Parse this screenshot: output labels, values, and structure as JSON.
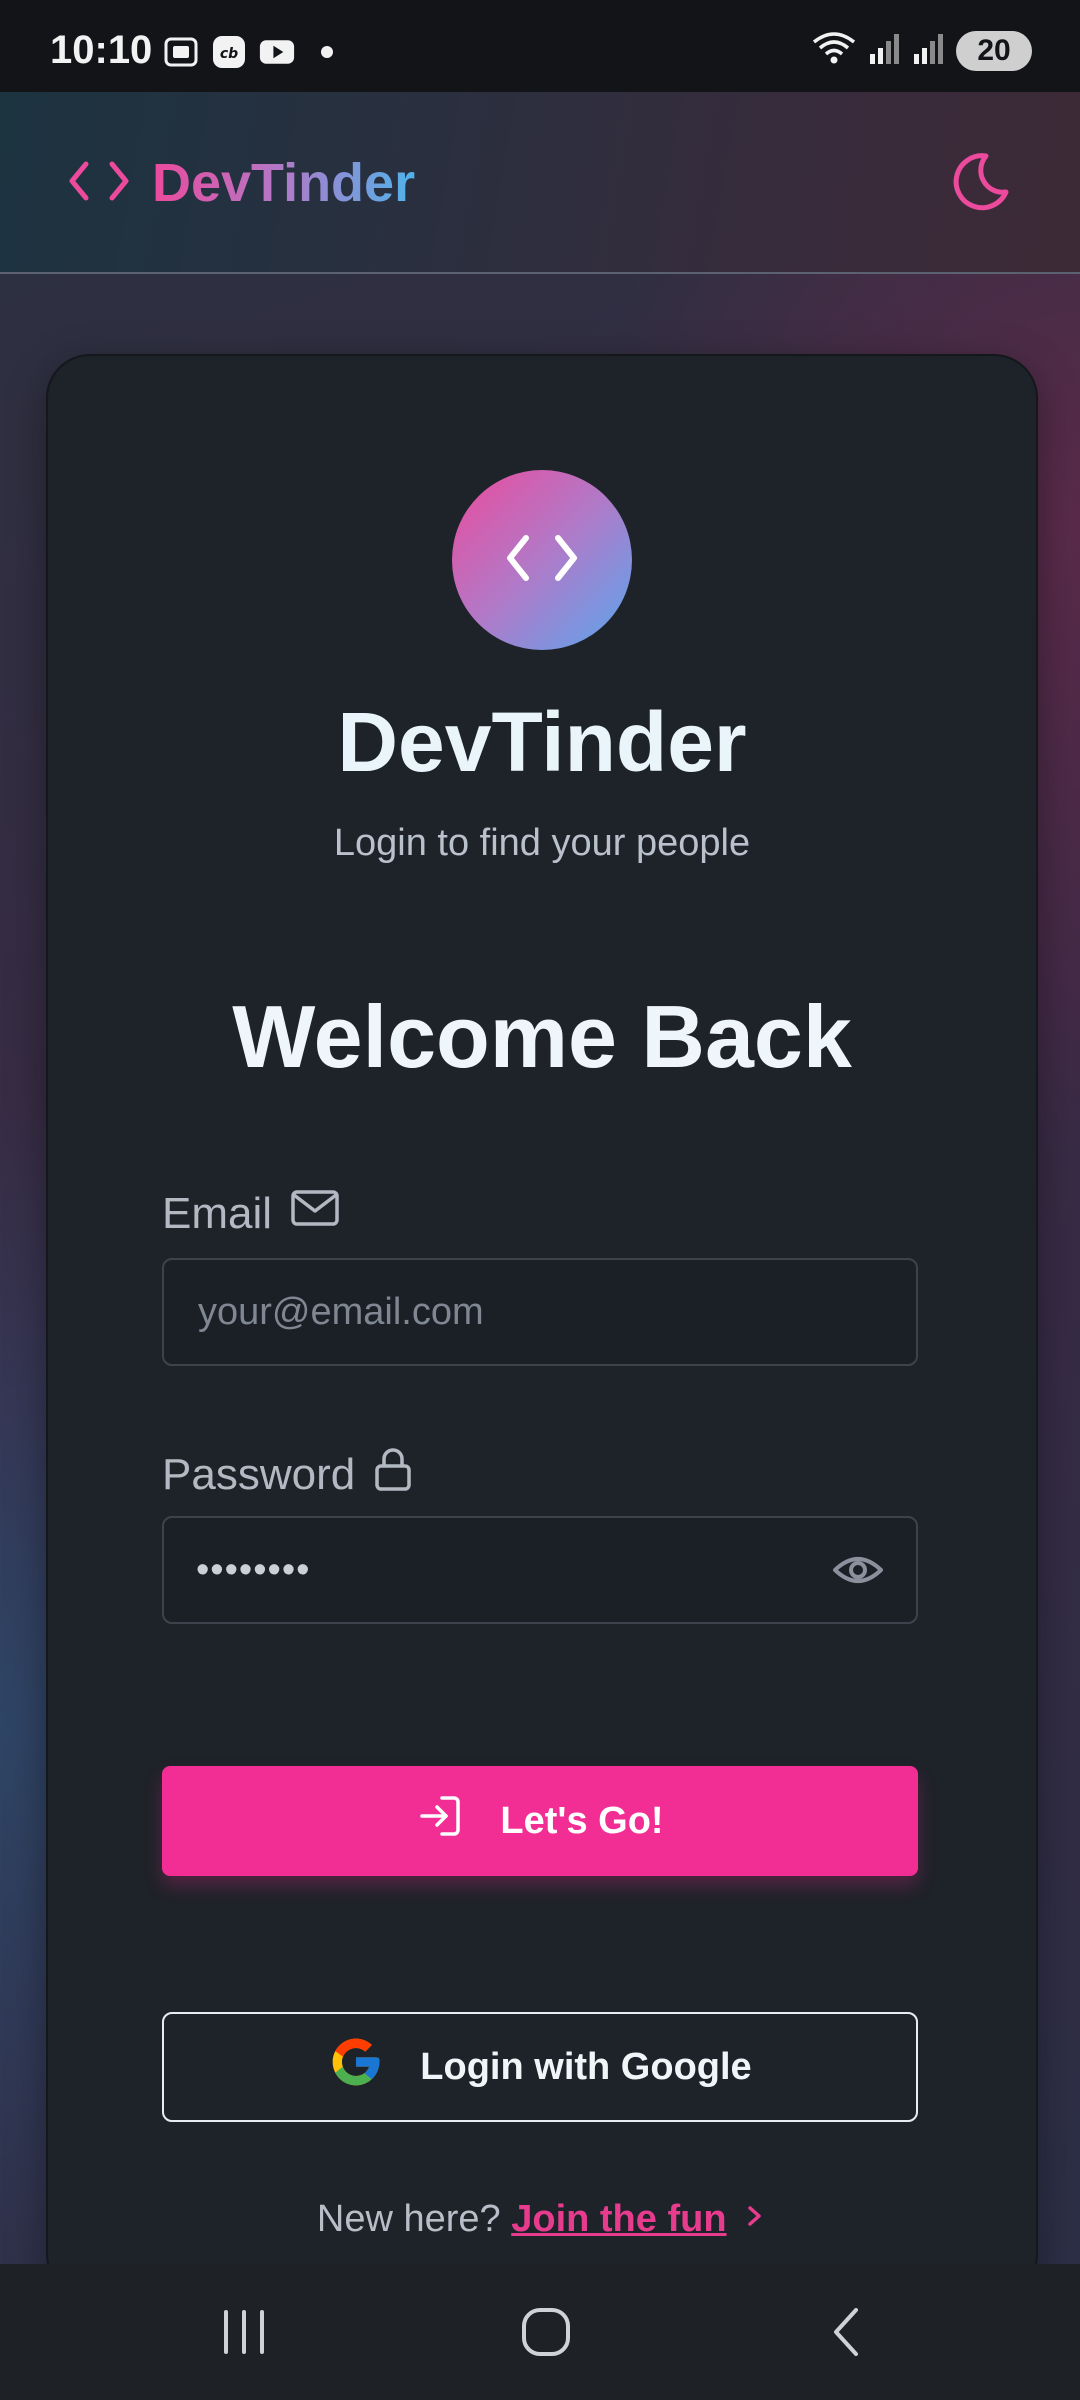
{
  "status_bar": {
    "time": "10:10",
    "battery": "20",
    "icons": [
      "gallery-icon",
      "cb-app-icon",
      "youtube-icon",
      "dot-icon",
      "wifi-icon",
      "signal-icon",
      "signal-icon"
    ]
  },
  "header": {
    "brand": "DevTinder",
    "brand_icon": "code-icon",
    "theme_icon": "moon-icon"
  },
  "card": {
    "title": "DevTinder",
    "subtitle": "Login to find your people",
    "heading": "Welcome Back",
    "email": {
      "label": "Email",
      "placeholder": "your@email.com",
      "value": ""
    },
    "password": {
      "label": "Password",
      "value": "••••••••"
    },
    "submit_label": "Let's Go!",
    "google_label": "Login with Google",
    "signup_prompt": "New here?",
    "signup_link": "Join the fun"
  },
  "colors": {
    "accent": "#f22d93",
    "card_bg": "#1e2229",
    "gradient_pink": "#ec4a9c",
    "gradient_blue": "#4fb3ea"
  },
  "nav_bar": {
    "icons": [
      "recent-apps-icon",
      "home-icon",
      "back-icon"
    ]
  }
}
